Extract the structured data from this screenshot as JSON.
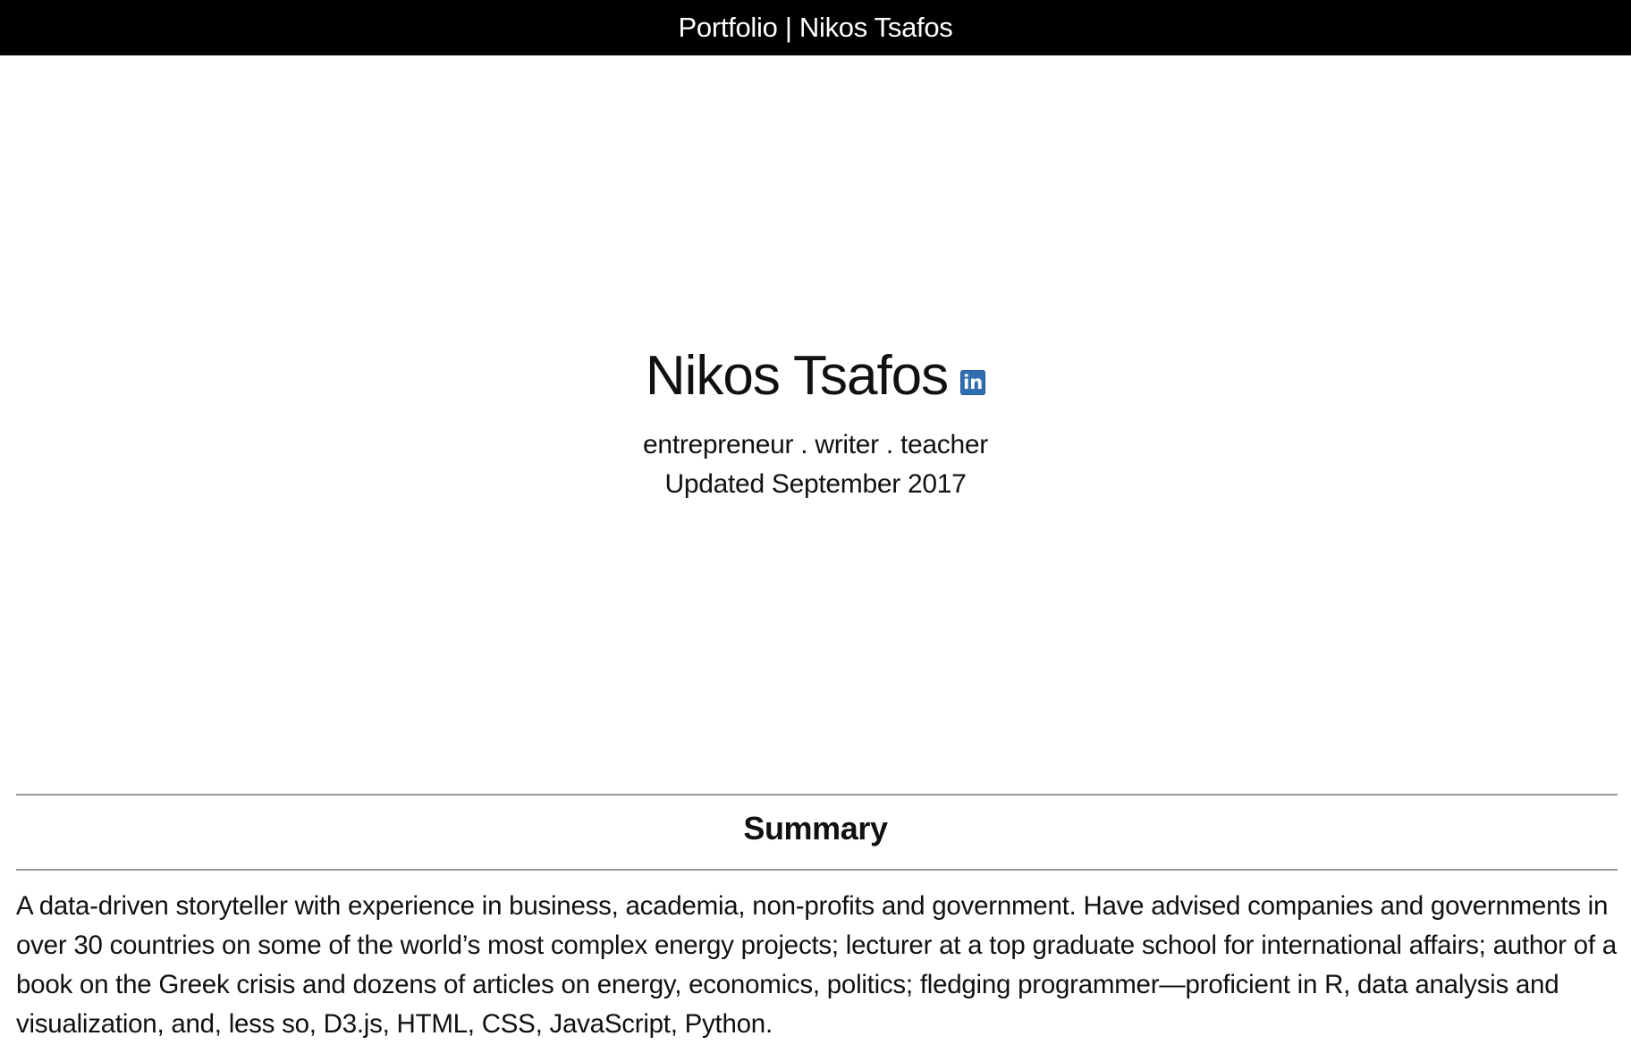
{
  "header": {
    "title": "Portfolio | Nikos Tsafos"
  },
  "hero": {
    "name": "Nikos Tsafos",
    "linkedin_icon_text": "in",
    "tagline": "entrepreneur . writer . teacher",
    "updated": "Updated September 2017"
  },
  "summary": {
    "heading": "Summary",
    "text": "A data-driven storyteller with experience in business, academia, non-profits and government. Have advised companies and governments in over 30 countries on some of the world’s most complex energy projects; lecturer at a top graduate school for international affairs; author of a book on the Greek crisis and dozens of articles on energy, economics, politics; fledging programmer—proficient in R, data analysis and visualization, and, less so, D3.js, HTML, CSS, JavaScript, Python."
  },
  "colors": {
    "topbar_bg": "#000000",
    "linkedin_blue": "#2f6fb0",
    "rule": "#9a9a9a"
  },
  "icons": {
    "linkedin": "linkedin-icon"
  }
}
